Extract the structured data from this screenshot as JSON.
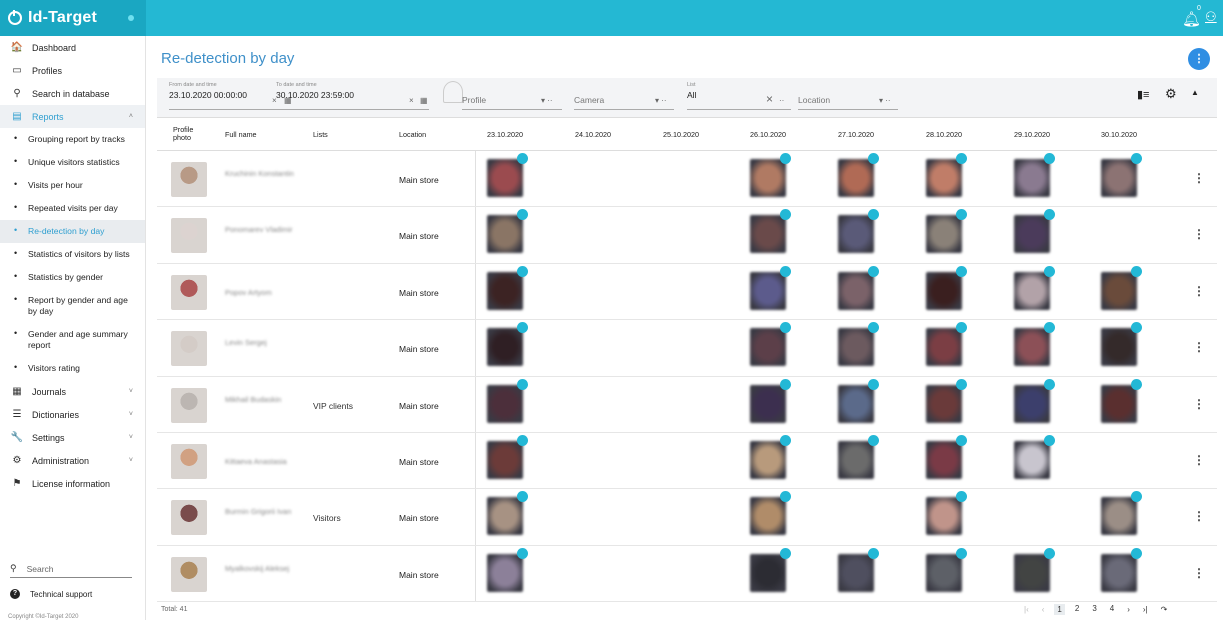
{
  "app": {
    "name": "Id-Target"
  },
  "sidebar": {
    "nav": [
      {
        "label": "Dashboard",
        "icon": "home-icon",
        "glyph": "🏠"
      },
      {
        "label": "Profiles",
        "icon": "profile-card-icon",
        "glyph": "▭"
      },
      {
        "label": "Search in database",
        "icon": "search-icon",
        "glyph": "⚲"
      },
      {
        "label": "Reports",
        "icon": "reports-icon",
        "glyph": "▤",
        "expanded": true
      }
    ],
    "reports_items": [
      "Grouping report by tracks",
      "Unique visitors statistics",
      "Visits per hour",
      "Repeated visits per day",
      "Re-detection by day",
      "Statistics of visitors by lists",
      "Statistics by gender",
      "Report by gender and age by day",
      "Gender and age summary report",
      "Visitors rating"
    ],
    "active_report": "Re-detection by day",
    "nav_bottom": [
      {
        "label": "Journals",
        "icon": "journals-icon",
        "glyph": "▦"
      },
      {
        "label": "Dictionaries",
        "icon": "list-icon",
        "glyph": "☰"
      },
      {
        "label": "Settings",
        "icon": "wrench-icon",
        "glyph": "🔧"
      },
      {
        "label": "Administration",
        "icon": "gear-icon",
        "glyph": "⚙"
      },
      {
        "label": "License information",
        "icon": "license-icon",
        "glyph": "⚑"
      }
    ],
    "search_placeholder": "Search",
    "support_label": "Technical support",
    "copyright": "Copyright ©Id-Target 2020"
  },
  "header": {
    "notification_count": "0"
  },
  "page": {
    "title": "Re-detection by day"
  },
  "filters": {
    "from_label": "From date and time",
    "from_value": "23.10.2020 00:00:00",
    "to_label": "To date and time",
    "to_value": "30.10.2020 23:59:00",
    "profile_placeholder": "Profile",
    "camera_placeholder": "Camera",
    "list_label": "List",
    "list_value": "All",
    "location_placeholder": "Location",
    "clear_mark": "×",
    "dropdown_mark": "▾ ··"
  },
  "table": {
    "headers": {
      "profile_photo": "Profile photo",
      "full_name": "Full name",
      "lists": "Lists",
      "location": "Location"
    },
    "dates": [
      "23.10.2020",
      "24.10.2020",
      "25.10.2020",
      "26.10.2020",
      "27.10.2020",
      "28.10.2020",
      "29.10.2020",
      "30.10.2020"
    ],
    "rows": [
      {
        "name": "Kruchinin Konstantin",
        "list": "",
        "location": "Main store",
        "photo_color": "#b89a86",
        "detections": [
          1,
          0,
          0,
          1,
          1,
          1,
          1,
          1
        ],
        "face_colors": [
          "#9b4b4f",
          "",
          "",
          "#b07a63",
          "#b06a55",
          "#c07d68",
          "#8a7a90",
          "#8c7373"
        ]
      },
      {
        "name": "Ponomarev Vladimir",
        "list": "",
        "location": "Main store",
        "photo_color": "#dcd3d0",
        "detections": [
          1,
          0,
          0,
          1,
          1,
          1,
          1,
          0
        ],
        "face_colors": [
          "#8a7565",
          "",
          "",
          "#6a4a4a",
          "#5a5a78",
          "#8a8178",
          "#4b3b5b",
          ""
        ]
      },
      {
        "name": "Popov Artyom",
        "list": "",
        "location": "Main store",
        "photo_color": "#b05a5a",
        "detections": [
          1,
          0,
          0,
          1,
          1,
          1,
          1,
          1
        ],
        "face_colors": [
          "#3c2323",
          "",
          "",
          "#5c5b8c",
          "#7b6269",
          "#3a1f1f",
          "#b2a2a8",
          "#6a4b3b"
        ]
      },
      {
        "name": "Levin Sergej",
        "list": "",
        "location": "Main store",
        "photo_color": "#d4ccc7",
        "detections": [
          1,
          0,
          0,
          1,
          1,
          1,
          1,
          1
        ],
        "face_colors": [
          "#2f1f24",
          "",
          "",
          "#5c3f49",
          "#6c5a5f",
          "#7b3e44",
          "#8c5057",
          "#342a2a"
        ]
      },
      {
        "name": "Mikhail Budaskin",
        "list": "VIP clients",
        "location": "Main store",
        "photo_color": "#bcb6b2",
        "detections": [
          1,
          0,
          0,
          1,
          1,
          1,
          1,
          1
        ],
        "face_colors": [
          "#4c2f3b",
          "",
          "",
          "#3c2f4f",
          "#5b6a8a",
          "#6a3a3a",
          "#3c3f6c",
          "#5a2f2f"
        ]
      },
      {
        "name": "Kittaeva Anastasia",
        "list": "",
        "location": "Main store",
        "photo_color": "#d1a182",
        "detections": [
          1,
          0,
          0,
          1,
          1,
          1,
          1,
          0
        ],
        "face_colors": [
          "#6c3b39",
          "",
          "",
          "#b89a7c",
          "#6b6b6b",
          "#7a3a46",
          "#c8c5ce",
          ""
        ]
      },
      {
        "name": "Burmin Grigorii Ivan",
        "list": "Visitors",
        "location": "Main store",
        "photo_color": "#7a4c4c",
        "detections": [
          1,
          0,
          0,
          1,
          0,
          1,
          0,
          1
        ],
        "face_colors": [
          "#a79283",
          "",
          "",
          "#b08c69",
          "",
          "#c0948a",
          "",
          "#9b8e86"
        ]
      },
      {
        "name": "Myalkovskij Aleksej",
        "list": "",
        "location": "Main store",
        "photo_color": "#b08d63",
        "detections": [
          1,
          0,
          0,
          1,
          1,
          1,
          1,
          1
        ],
        "face_colors": [
          "#8c8099",
          "",
          "",
          "#2c2c33",
          "#4f4f5f",
          "#5d6067",
          "#424443",
          "#6a6a78"
        ]
      }
    ],
    "row_menu_glyph": "⋮"
  },
  "footer": {
    "total": "Total: 41",
    "pages": [
      "1",
      "2",
      "3",
      "4"
    ],
    "current_page": "1"
  },
  "colors": {
    "accent": "#24b8d3",
    "badge": "#23b8d6",
    "link": "#3f90c9"
  }
}
